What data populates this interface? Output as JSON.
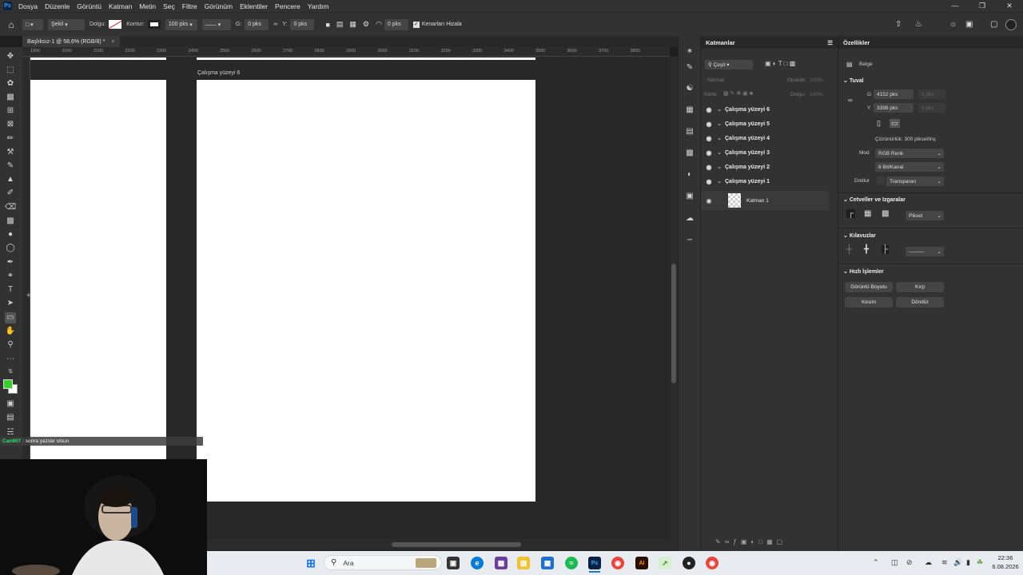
{
  "menu": {
    "app_icon": "Ps",
    "items": [
      "Dosya",
      "Düzenle",
      "Görüntü",
      "Katman",
      "Metin",
      "Seç",
      "Filtre",
      "Görünüm",
      "Eklentiler",
      "Pencere",
      "Yardım"
    ],
    "window_controls": [
      "minimize-icon",
      "restore-icon",
      "close-icon"
    ]
  },
  "options": {
    "shape_mode": "Şekil",
    "fill_label": "Dolgu:",
    "stroke_label": "Kontur:",
    "stroke_width": "100 pks",
    "w_label": "G:",
    "w_value": "0 pks",
    "link_icon": "link-icon",
    "h_label": "Y:",
    "h_value": "0 pks",
    "corner_value": "0 pks",
    "align_edges_label": "Kenarları Hizala",
    "align_edges_checked": true
  },
  "document": {
    "tab_title": "Başlıksız-1 @ 58,6% (RGB/8) *",
    "tab_close": "×",
    "artboard_label": "Çalışma yüzeyi 6"
  },
  "ruler": {
    "top_numbers": [
      "1900",
      "2000",
      "2100",
      "2200",
      "2300",
      "2400",
      "2500",
      "2600",
      "2700",
      "2800",
      "2900",
      "3000",
      "3100",
      "3200",
      "3300",
      "3400",
      "3500",
      "3600",
      "3700",
      "3800"
    ]
  },
  "colors": {
    "foreground": "#39d02c",
    "background": "#ffffff",
    "ps_accent": "#31a8ff"
  },
  "layers_panel": {
    "title": "Katmanlar",
    "filter": "Çeşit",
    "blend_mode": "Normal",
    "opacity_label": "Opaklık:",
    "opacity_value": "100%",
    "lock_label": "Kilitle:",
    "fill_label": "Dolgu:",
    "fill_value": "100%",
    "layers": [
      {
        "name": "Çalışma yüzeyi 6",
        "type": "artboard"
      },
      {
        "name": "Çalışma yüzeyi 5",
        "type": "artboard"
      },
      {
        "name": "Çalışma yüzeyi 4",
        "type": "artboard"
      },
      {
        "name": "Çalışma yüzeyi 3",
        "type": "artboard"
      },
      {
        "name": "Çalışma yüzeyi 2",
        "type": "artboard"
      },
      {
        "name": "Çalışma yüzeyi 1",
        "type": "artboard"
      },
      {
        "name": "Katman 1",
        "type": "layer"
      }
    ]
  },
  "properties": {
    "title": "Özellikler",
    "doc_label": "Belge",
    "canvas_section": "Tuval",
    "width_label": "G",
    "width_value": "4152 pks",
    "x_label": "X",
    "x_value": "0 pks",
    "height_label": "Y",
    "height_value": "3398 pks",
    "y_label": "Y",
    "y_value": "0 pks",
    "resolution": "Çözünürlük: 300 piksel/inç",
    "mode_label": "Mod",
    "mode_value": "RGB Renk",
    "depth_value": "8 Bit/Kanal",
    "fill_label": "Doldur",
    "fill_value": "Transparan",
    "rulers_section": "Cetveller ve Izgaralar",
    "units_value": "Piksel",
    "guides_section": "Kılavuzlar",
    "quick_section": "Hızlı İşlemler",
    "buttons": [
      "Görüntü Boyutu",
      "Kırp",
      "Kesim",
      "Döndür"
    ]
  },
  "chat": {
    "user": "Can907",
    "message": ": sonra yazılar olsun"
  },
  "taskbar": {
    "search_placeholder": "Ara",
    "time": "22:36",
    "date": "6.08.2026"
  }
}
